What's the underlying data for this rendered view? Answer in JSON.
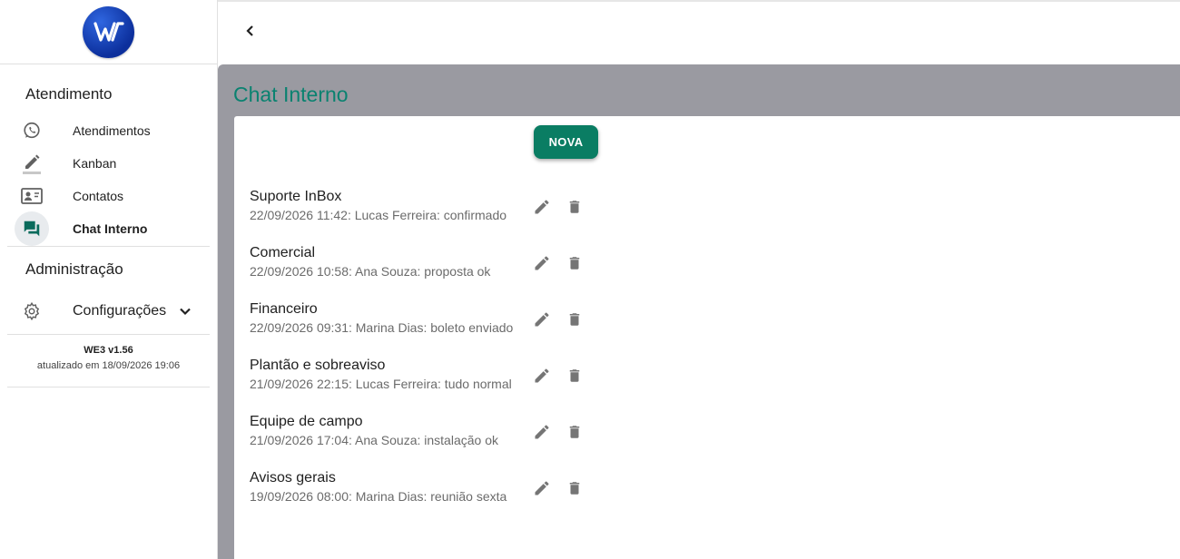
{
  "app": {
    "logo_alt": "WE3 logo"
  },
  "sidebar": {
    "section_atendimento": "Atendimento",
    "items": [
      {
        "label": "Atendimentos",
        "icon": "whatsapp-icon"
      },
      {
        "label": "Kanban",
        "icon": "pencil-icon"
      },
      {
        "label": "Contatos",
        "icon": "contact-card-icon"
      },
      {
        "label": "Chat Interno",
        "icon": "chat-icon",
        "active": true
      }
    ],
    "section_admin": "Administração",
    "config_label": "Configurações",
    "version": "WE3 v1.56",
    "updated": "atualizado em 18/09/2026 19:06"
  },
  "main": {
    "title": "Chat Interno",
    "new_button": "NOVA",
    "chats": [
      {
        "name": "Suporte InBox",
        "last": "22/09/2026 11:42: Lucas Ferreira: confirmado"
      },
      {
        "name": "Comercial",
        "last": "22/09/2026 10:58: Ana Souza: proposta ok"
      },
      {
        "name": "Financeiro",
        "last": "22/09/2026 09:31: Marina Dias: boleto enviado"
      },
      {
        "name": "Plantão e sobreaviso",
        "last": "21/09/2026 22:15: Lucas Ferreira: tudo normal"
      },
      {
        "name": "Equipe de campo",
        "last": "21/09/2026 17:04: Ana Souza: instalação ok"
      },
      {
        "name": "Avisos gerais",
        "last": "19/09/2026 08:00: Marina Dias: reunião sexta"
      }
    ]
  },
  "colors": {
    "accent": "#0a8270",
    "button": "#0a7d63",
    "backdrop": "#9a9aa1",
    "logo": "#1a47c4"
  }
}
